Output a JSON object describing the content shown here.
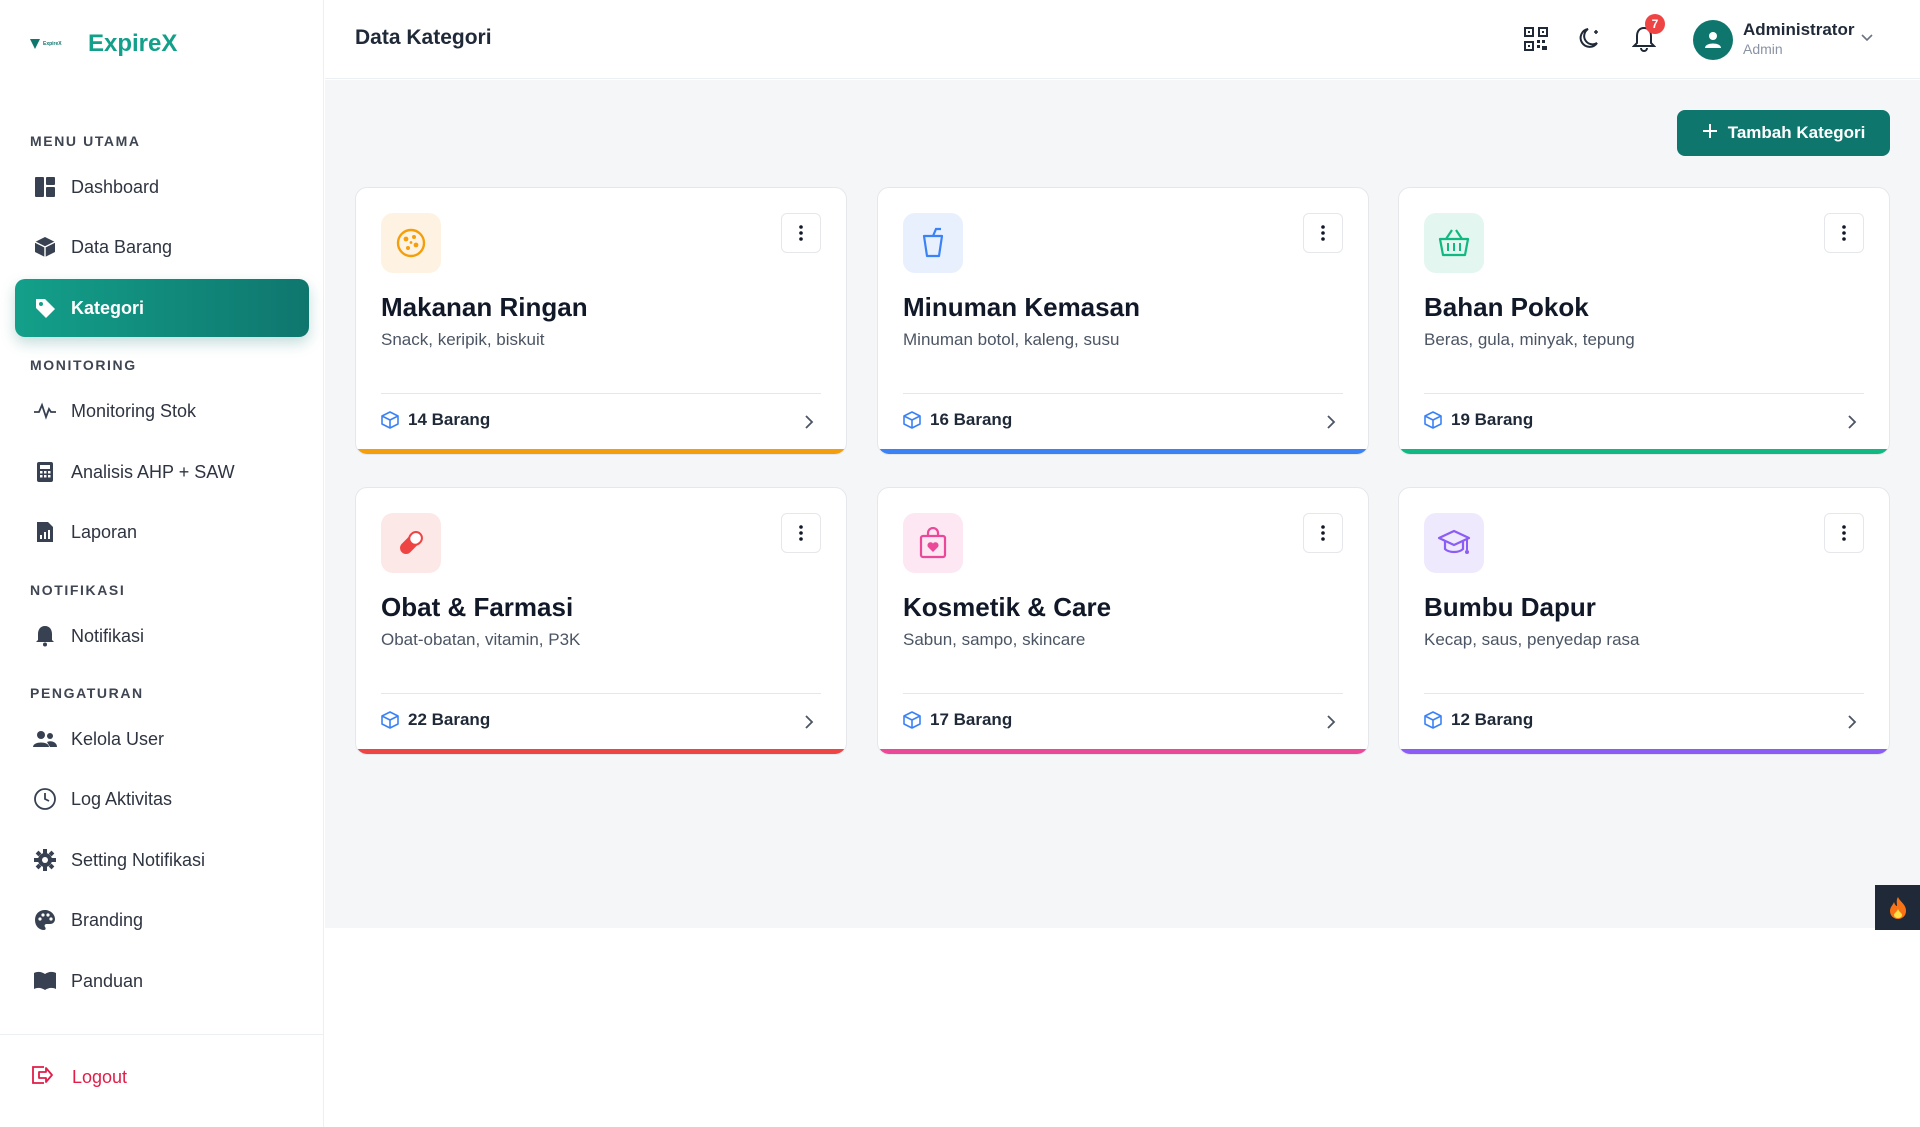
{
  "brand": {
    "name": "ExpireX",
    "logo_text": "ExpireX"
  },
  "sidebar": {
    "sections": {
      "menu_utama": "MENU UTAMA",
      "monitoring": "MONITORING",
      "notifikasi": "NOTIFIKASI",
      "pengaturan": "PENGATURAN"
    },
    "items": [
      {
        "label": "Dashboard",
        "icon": "dashboard-icon"
      },
      {
        "label": "Data Barang",
        "icon": "box-icon"
      },
      {
        "label": "Kategori",
        "icon": "tag-icon",
        "active": true
      },
      {
        "label": "Monitoring Stok",
        "icon": "pulse-icon"
      },
      {
        "label": "Analisis AHP + SAW",
        "icon": "calculator-icon"
      },
      {
        "label": "Laporan",
        "icon": "report-icon"
      },
      {
        "label": "Notifikasi",
        "icon": "bell-icon"
      },
      {
        "label": "Kelola User",
        "icon": "users-icon"
      },
      {
        "label": "Log Aktivitas",
        "icon": "clock-icon"
      },
      {
        "label": "Setting Notifikasi",
        "icon": "gear-icon"
      },
      {
        "label": "Branding",
        "icon": "palette-icon"
      },
      {
        "label": "Panduan",
        "icon": "book-icon"
      }
    ],
    "logout": "Logout"
  },
  "header": {
    "title": "Data Kategori",
    "notification_count": "7",
    "user": {
      "name": "Administrator",
      "role": "Admin"
    }
  },
  "main": {
    "add_button": "Tambah Kategori",
    "categories": [
      {
        "name": "Makanan Ringan",
        "desc": "Snack, keripik, biskuit",
        "count": "14 Barang",
        "icon": "cookie-icon",
        "color": "#f59e0b",
        "bg": "#fef3e2"
      },
      {
        "name": "Minuman Kemasan",
        "desc": "Minuman botol, kaleng, susu",
        "count": "16 Barang",
        "icon": "cup-icon",
        "color": "#3b82f6",
        "bg": "#e8f0fd"
      },
      {
        "name": "Bahan Pokok",
        "desc": "Beras, gula, minyak, tepung",
        "count": "19 Barang",
        "icon": "basket-icon",
        "color": "#10b981",
        "bg": "#e3f6ef"
      },
      {
        "name": "Obat & Farmasi",
        "desc": "Obat-obatan, vitamin, P3K",
        "count": "22 Barang",
        "icon": "pill-icon",
        "color": "#ef4444",
        "bg": "#fde8e8"
      },
      {
        "name": "Kosmetik & Care",
        "desc": "Sabun, sampo, skincare",
        "count": "17 Barang",
        "icon": "shopping-bag-icon",
        "color": "#ec4899",
        "bg": "#fce7f3"
      },
      {
        "name": "Bumbu Dapur",
        "desc": "Kecap, saus, penyedap rasa",
        "count": "12 Barang",
        "icon": "graduation-cap-icon",
        "color": "#8b5cf6",
        "bg": "#efe9fd"
      }
    ]
  }
}
